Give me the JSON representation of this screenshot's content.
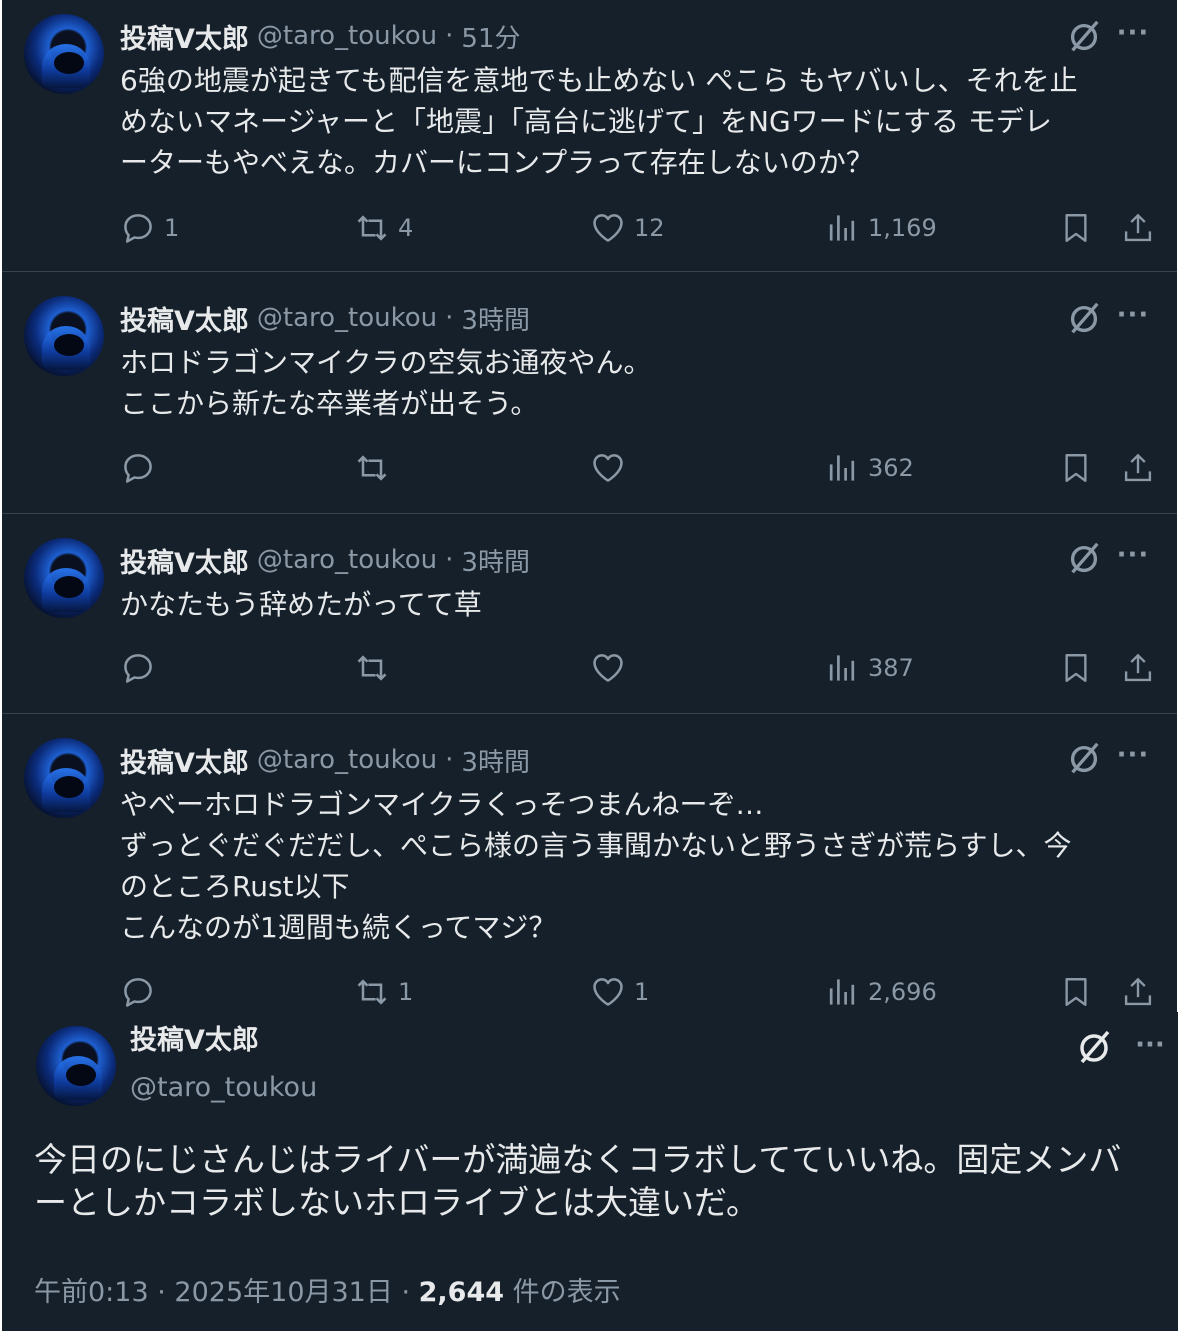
{
  "user": {
    "name": "投稿V太郎",
    "handle": "@taro_toukou"
  },
  "posts": [
    {
      "time": "51分",
      "lines": [
        "6強の地震が起きても配信を意地でも止めない ぺこら もヤバいし、それを止",
        "めないマネージャーと「地震」「高台に逃げて」をNGワードにする モデレ",
        "ーターもやべえな。カバーにコンプラって存在しないのか？"
      ],
      "replies": "1",
      "reposts": "4",
      "likes": "12",
      "views": "1,169"
    },
    {
      "time": "3時間",
      "lines": [
        "ホロドラゴンマイクラの空気お通夜やん。",
        "ここから新たな卒業者が出そう。"
      ],
      "replies": "",
      "reposts": "",
      "likes": "",
      "views": "362"
    },
    {
      "time": "3時間",
      "lines": [
        "かなたもう辞めたがってて草"
      ],
      "replies": "",
      "reposts": "",
      "likes": "",
      "views": "387"
    },
    {
      "time": "3時間",
      "lines": [
        "やべーホロドラゴンマイクラくっそつまんねーぞ…",
        "ずっとぐだぐだだし、ぺこら様の言う事聞かないと野うさぎが荒らすし、今",
        "のところRust以下",
        "こんなのが1週間も続くってマジ？"
      ],
      "replies": "",
      "reposts": "1",
      "likes": "1",
      "views": "2,696"
    }
  ],
  "main_post": {
    "lines": [
      "今日のにじさんじはライバーが満遍なくコラボしてていいね。固定メンバ",
      "ーとしかコラボしないホロライブとは大違いだ。"
    ],
    "time": "午前0:13",
    "date": "2025年10月31日",
    "views_count": "2,644",
    "views_label": "件の表示",
    "separator": "·"
  },
  "icons": [
    "avatar",
    "grok-icon",
    "more-icon",
    "reply-icon",
    "repost-icon",
    "like-icon",
    "views-icon",
    "bookmark-icon",
    "share-icon"
  ],
  "colors": {
    "background": "#15202b",
    "text": "#e7e9ea",
    "muted": "#8b98a5",
    "divider": "#38444d"
  }
}
